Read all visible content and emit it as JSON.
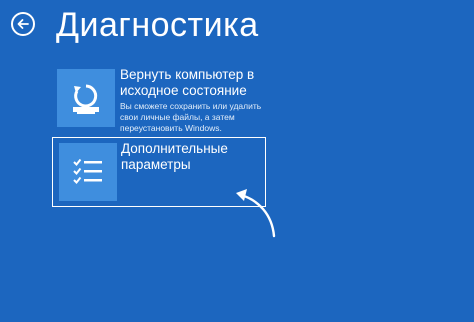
{
  "header": {
    "title": "Диагностика",
    "back_icon": "back-arrow-icon"
  },
  "options": {
    "reset": {
      "title": "Вернуть компьютер в исходное состояние",
      "description": "Вы сможете сохранить или удалить свои личные файлы, а затем переустановить Windows.",
      "icon": "reset-pc-icon"
    },
    "advanced": {
      "title": "Дополнительные параметры",
      "icon": "checklist-icon",
      "selected": true
    }
  },
  "annotation": {
    "icon": "curved-pointer-arrow-icon"
  },
  "colors": {
    "background": "#1c66bf",
    "tile_icon_bg": "#3f8ede",
    "text": "#ffffff"
  }
}
